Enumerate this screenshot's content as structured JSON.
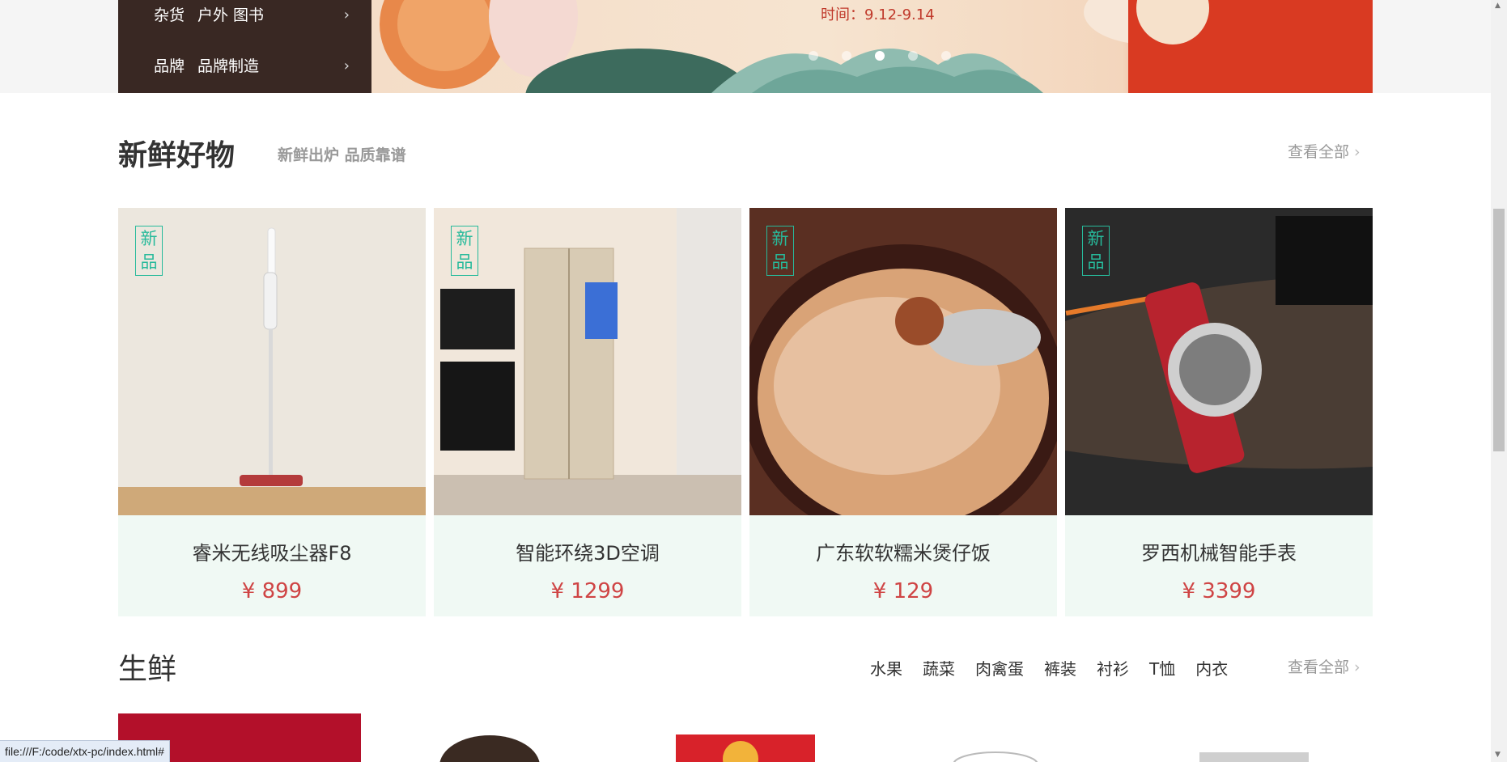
{
  "category_menu": [
    {
      "label_1": "杂货",
      "label_2": "户外 图书",
      "chevron": "›"
    },
    {
      "label_1": "品牌",
      "label_2": "品牌制造",
      "chevron": "›"
    }
  ],
  "banner": {
    "time_text": "时间：9.12-9.14",
    "dot_count": 5,
    "active_dot": 3
  },
  "new_goods": {
    "title": "新鲜好物",
    "subtitle": "新鲜出炉 品质靠谱",
    "view_all": "查看全部",
    "view_all_icon": "›",
    "tag_line1": "新",
    "tag_line2": "品",
    "items": [
      {
        "name": "睿米无线吸尘器F8",
        "price": "¥ 899"
      },
      {
        "name": "智能环绕3D空调",
        "price": "¥ 1299"
      },
      {
        "name": "广东软软糯米煲仔饭",
        "price": "¥ 129"
      },
      {
        "name": "罗西机械智能手表",
        "price": "¥ 3399"
      }
    ]
  },
  "fresh": {
    "title": "生鲜",
    "tabs": [
      "水果",
      "蔬菜",
      "肉禽蛋",
      "裤装",
      "衬衫",
      "T恤",
      "内衣"
    ],
    "view_all": "查看全部",
    "view_all_icon": "›"
  },
  "status_bar": "file:///F:/code/xtx-pc/index.html#",
  "colors": {
    "brand": "#27ba9b",
    "price": "#cf4444",
    "card_bg": "#f0f9f4"
  }
}
